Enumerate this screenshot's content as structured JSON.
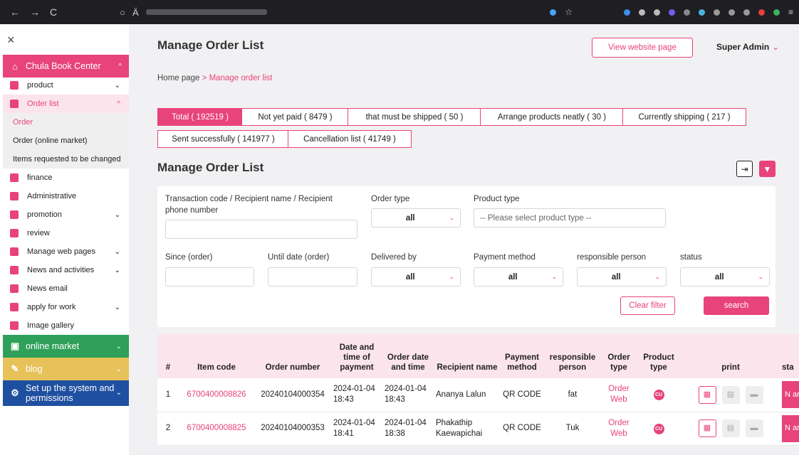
{
  "browser": {
    "nav": [
      "←",
      "→",
      "C"
    ],
    "url_icons": [
      "○",
      "Ä"
    ]
  },
  "sidebar": {
    "close": "×",
    "brand": {
      "label": "Chula Book Center",
      "color": "#e8437a"
    },
    "items": [
      {
        "label": "product",
        "chev": "⌄"
      },
      {
        "label": "Order list",
        "chev": "^"
      }
    ],
    "order_subitems": [
      "Order",
      "Order (online market)",
      "Items requested to be changed"
    ],
    "items2": [
      {
        "label": "finance",
        "chev": ""
      },
      {
        "label": "Administrative",
        "chev": ""
      },
      {
        "label": "promotion",
        "chev": "⌄"
      },
      {
        "label": "review",
        "chev": ""
      },
      {
        "label": "Manage web pages",
        "chev": "⌄"
      },
      {
        "label": "News and activities",
        "chev": "⌄"
      },
      {
        "label": "News email",
        "chev": ""
      },
      {
        "label": "apply for work",
        "chev": "⌄"
      },
      {
        "label": "Image gallery",
        "chev": ""
      }
    ],
    "sections": [
      {
        "label": "online market",
        "color": "#2fa05a"
      },
      {
        "label": "blog",
        "color": "#e7c15a"
      },
      {
        "label": "Set up the system and permissions",
        "color": "#1f4fa0"
      }
    ]
  },
  "header": {
    "title": "Manage Order List",
    "view_website": "View website page",
    "user": "Super Admin",
    "caret": "⌄"
  },
  "breadcrumb": {
    "home": "Home page",
    "sep": ">",
    "current": "Manage order list"
  },
  "tabs": [
    "Total ( 192519 )",
    "Not yet paid ( 8479 )",
    "that must be shipped ( 50 )",
    "Arrange products neatly ( 30 )",
    "Currently shipping ( 217 )",
    "Sent successfully ( 141977 )",
    "Cancellation list ( 41749 )"
  ],
  "section_title": "Manage Order List",
  "filters": {
    "transaction_label": "Transaction code / Recipient name / Recipient phone number",
    "order_type_label": "Order type",
    "order_type_value": "all",
    "product_type_label": "Product type",
    "product_type_placeholder": "-- Please select product type --",
    "since_label": "Since (order)",
    "until_label": "Until date (order)",
    "delivered_label": "Delivered by",
    "delivered_value": "all",
    "payment_label": "Payment method",
    "payment_value": "all",
    "responsible_label": "responsible person",
    "responsible_value": "all",
    "status_label": "status",
    "status_value": "all",
    "clear": "Clear filter",
    "search": "search"
  },
  "table": {
    "headers": [
      "#",
      "Item code",
      "Order number",
      "Date and time of payment",
      "Order date and time",
      "Recipient name",
      "Payment method",
      "responsible person",
      "Order type",
      "Product type",
      "print",
      "sta"
    ],
    "rows": [
      {
        "num": "1",
        "item_code": "6700400008826",
        "order_number": "20240104000354",
        "pay_date": "2024-01-04",
        "pay_time": "18:43",
        "order_date": "2024-01-04",
        "order_time": "18:43",
        "recipient": "Ananya Lalun",
        "payment": "QR CODE",
        "person": "fat",
        "order_type": "Order Web",
        "product_type": "CU",
        "status": "N ar"
      },
      {
        "num": "2",
        "item_code": "6700400008825",
        "order_number": "20240104000353",
        "pay_date": "2024-01-04",
        "pay_time": "18:41",
        "order_date": "2024-01-04",
        "order_time": "18:38",
        "recipient": "Phakathip Kaewapichai",
        "payment": "QR CODE",
        "person": "Tuk",
        "order_type": "Order Web",
        "product_type": "CU",
        "status": "N ar"
      }
    ]
  },
  "colors": {
    "accent": "#e8437a",
    "header_row": "#fbe4ec"
  }
}
